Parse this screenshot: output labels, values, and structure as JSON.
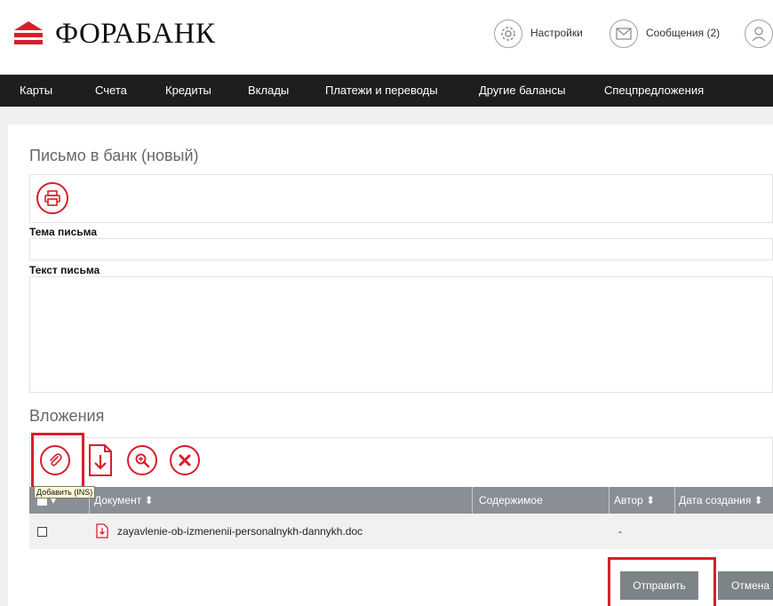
{
  "brand": {
    "name": "ФОРАБАНК",
    "accent": "#d81e2c"
  },
  "header": {
    "settings_label": "Настройки",
    "messages_label": "Сообщения (2)"
  },
  "nav": {
    "items": [
      {
        "label": "Карты"
      },
      {
        "label": "Счета"
      },
      {
        "label": "Кредиты"
      },
      {
        "label": "Вклады"
      },
      {
        "label": "Платежи и переводы"
      },
      {
        "label": "Другие балансы"
      },
      {
        "label": "Спецпредложения"
      }
    ]
  },
  "form": {
    "title": "Письмо в банк (новый)",
    "subject_label": "Тема письма",
    "subject_value": "",
    "body_label": "Текст письма",
    "body_value": ""
  },
  "attachments": {
    "title": "Вложения",
    "tooltip": "Добавить (INS)",
    "columns": [
      "Документ",
      "Содержимое",
      "Автор",
      "Дата создания"
    ],
    "rows": [
      {
        "document": "zayavlenie-ob-izmenenii-personalnykh-dannykh.doc",
        "content": "",
        "author": "-",
        "created": ""
      }
    ]
  },
  "actions": {
    "send_label": "Отправить",
    "cancel_label": "Отмена"
  }
}
